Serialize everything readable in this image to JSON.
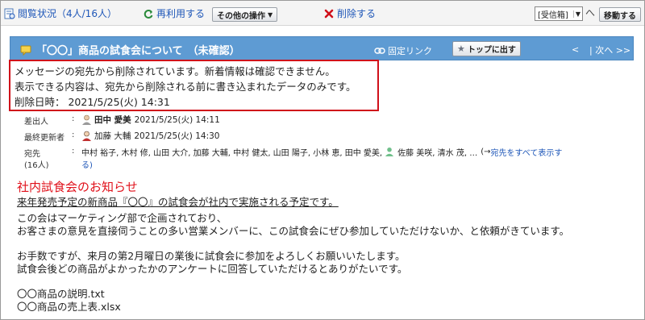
{
  "toolbar": {
    "read_status": "閲覧状況（4人/16人）",
    "reuse": "再利用する",
    "other_ops": "その他の操作",
    "delete": "削除する",
    "folder_select": "[受信箱]",
    "move_button": "移動する"
  },
  "message": {
    "title": "「〇〇」商品の試食会について",
    "status": "（未確認）",
    "fixed_link": "固定リンク",
    "top_button": "トップに出す",
    "nav_prev": "<",
    "nav_next": "| 次へ >>"
  },
  "notice": {
    "line1": "メッセージの宛先から削除されています。新着情報は確認できません。",
    "line2": "表示できる内容は、宛先から削除される前に書き込まれたデータのみです。",
    "line3": "削除日時： 2021/5/25(火) 14:31"
  },
  "meta": {
    "sender_label": "差出人",
    "sender_name": "田中 愛美",
    "sender_time": "2021/5/25(火) 14:11",
    "updater_label": "最終更新者",
    "updater_name": "加藤 大輔",
    "updater_time": "2021/5/25(火) 14:30",
    "recipients_label": "宛先",
    "recipients_count": "(16人)",
    "colon": ":",
    "recipients_line1_a": "中村 裕子, 木村 修, 山田 大介, 加藤 大輔, 中村 健太, 山田 陽子, 小林 恵, 田中 愛美,",
    "recipients_line1_b": "佐藤 美咲, 清水 茂, …",
    "show_all_prefix": "(→",
    "show_all_link": "宛先をすべて表示す",
    "recipients_line2": "る)"
  },
  "body": {
    "heading": "社内試食会のお知らせ",
    "line1": "来年発売予定の新商品『〇〇』の試食会が社内で実施される予定です。",
    "line2": "この会はマーケティング部で企画されており、",
    "line3": "お客さまの意見を直接伺うことの多い営業メンバーに、この試食会にぜひ参加していただけないか、と依頼がきています。",
    "line4": "お手数ですが、来月の第2月曜日の業後に試食会に参加をよろしくお願いいたします。",
    "line5": "試食会後どの商品がよかったかのアンケートに回答していただけるとありがたいです。",
    "file1": "〇〇商品の説明.txt",
    "file2": "〇〇商品の売上表.xlsx"
  }
}
